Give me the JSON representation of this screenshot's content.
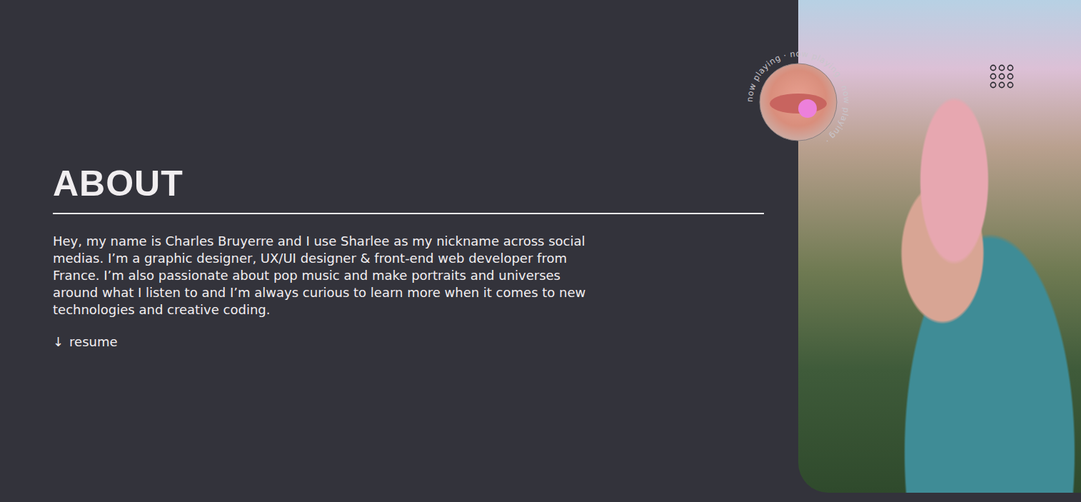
{
  "about": {
    "title": "ABOUT",
    "bio": "Hey, my name is Charles Bruyerre and I use Sharlee as my nickname across social medias. I’m a graphic designer, UX/UI designer & front-end web developer from France. I’m also passionate about pop music and make portraits and universes around what I listen to and I’m always curious to learn more when it comes to new technologies and creative coding.",
    "resume": {
      "arrow": "↓",
      "label": "resume"
    }
  },
  "now_playing": {
    "label": "now playing · now playing · now playing ·"
  }
}
